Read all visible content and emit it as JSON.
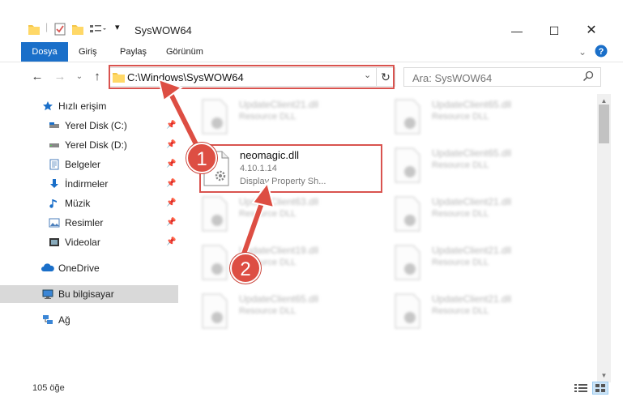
{
  "window": {
    "title": "SysWOW64"
  },
  "ribbon": {
    "tabs": [
      {
        "label": "Dosya"
      },
      {
        "label": "Giriş"
      },
      {
        "label": "Paylaş"
      },
      {
        "label": "Görünüm"
      }
    ]
  },
  "address": {
    "path": "C:\\Windows\\SysWOW64"
  },
  "search": {
    "placeholder": "Ara: SysWOW64"
  },
  "sidebar": {
    "items": [
      {
        "label": "Hızlı erişim"
      },
      {
        "label": "Yerel Disk (C:)"
      },
      {
        "label": "Yerel Disk (D:)"
      },
      {
        "label": "Belgeler"
      },
      {
        "label": "İndirmeler"
      },
      {
        "label": "Müzik"
      },
      {
        "label": "Resimler"
      },
      {
        "label": "Videolar"
      },
      {
        "label": "OneDrive"
      },
      {
        "label": "Bu bilgisayar"
      },
      {
        "label": "Ağ"
      }
    ]
  },
  "files": [
    {
      "name": "UpdateClient21.dll",
      "desc": "Resource DLL"
    },
    {
      "name": "UpdateClient65.dll",
      "desc": "Resource DLL"
    },
    {
      "name": "neomagic.dll",
      "version": "4.10.1.14",
      "desc": "Display Property Sh..."
    },
    {
      "name": "UpdateClient65.dll",
      "desc": "Resource DLL"
    },
    {
      "name": "UpdateClient63.dll",
      "desc": "Resource DLL"
    },
    {
      "name": "UpdateClient21.dll",
      "desc": "Resource DLL"
    },
    {
      "name": "UpdateClient19.dll",
      "desc": "Resource DLL"
    },
    {
      "name": "UpdateClient21.dll",
      "desc": "Resource DLL"
    },
    {
      "name": "UpdateClient65.dll",
      "desc": "Resource DLL"
    },
    {
      "name": "UpdateClient21.dll",
      "desc": "Resource DLL"
    }
  ],
  "status": {
    "item_count": "105 öğe"
  },
  "annotations": {
    "step1": "1",
    "step2": "2",
    "color": "#dd4e43"
  },
  "colors": {
    "accent": "#1a6fc9",
    "highlight": "#d9534f"
  }
}
